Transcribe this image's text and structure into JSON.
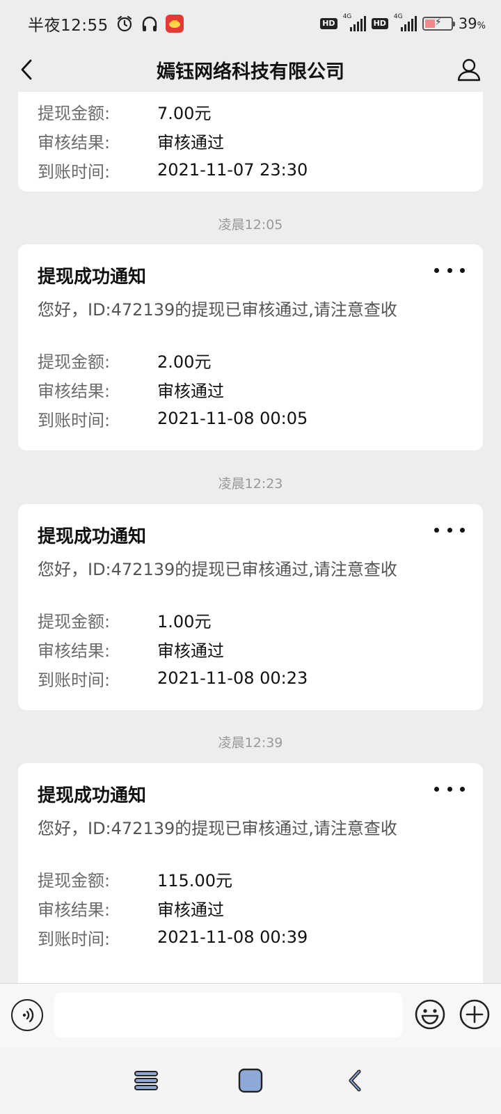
{
  "status_bar": {
    "time": "半夜12:55",
    "hd1": "HD",
    "net1": "4G",
    "hd2": "HD",
    "net2": "4G",
    "battery_level": 0.39,
    "battery_text": "39",
    "battery_unit": "%"
  },
  "nav": {
    "title": "嫣钰网络科技有限公司"
  },
  "partial_card": {
    "rows": [
      {
        "label": "提现金额:",
        "value": "7.00元"
      },
      {
        "label": "审核结果:",
        "value": "审核通过"
      },
      {
        "label": "到账时间:",
        "value": "2021-11-07 23:30"
      }
    ]
  },
  "messages": [
    {
      "timestamp": "凌晨12:05",
      "title": "提现成功通知",
      "description": "您好，ID:472139的提现已审核通过,请注意查收",
      "rows": [
        {
          "label": "提现金额:",
          "value": "2.00元"
        },
        {
          "label": "审核结果:",
          "value": "审核通过"
        },
        {
          "label": "到账时间:",
          "value": "2021-11-08 00:05"
        }
      ]
    },
    {
      "timestamp": "凌晨12:23",
      "title": "提现成功通知",
      "description": "您好，ID:472139的提现已审核通过,请注意查收",
      "rows": [
        {
          "label": "提现金额:",
          "value": "1.00元"
        },
        {
          "label": "审核结果:",
          "value": "审核通过"
        },
        {
          "label": "到账时间:",
          "value": "2021-11-08 00:23"
        }
      ]
    },
    {
      "timestamp": "凌晨12:39",
      "title": "提现成功通知",
      "description": "您好，ID:472139的提现已审核通过,请注意查收",
      "rows": [
        {
          "label": "提现金额:",
          "value": "115.00元"
        },
        {
          "label": "审核结果:",
          "value": "审核通过"
        },
        {
          "label": "到账时间:",
          "value": "2021-11-08 00:39"
        }
      ]
    }
  ],
  "input_bar": {
    "placeholder": ""
  },
  "icons": {
    "back": "chevron-left-icon",
    "profile": "person-icon",
    "more": "more-dots-icon",
    "voice": "voice-icon",
    "emoji": "emoji-icon",
    "plus": "plus-icon",
    "alarm": "alarm-icon",
    "headphones": "headphones-icon"
  }
}
